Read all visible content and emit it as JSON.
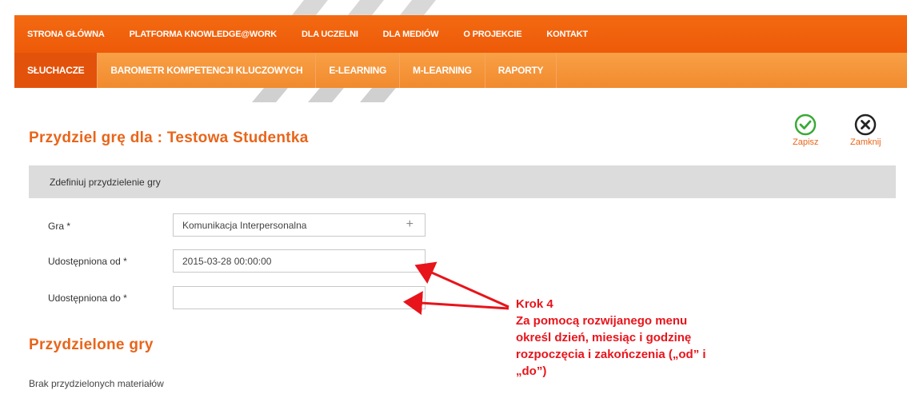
{
  "topnav": {
    "items": [
      "STRONA GŁÓWNA",
      "PLATFORMA KNOWLEDGE@WORK",
      "DLA UCZELNI",
      "DLA MEDIÓW",
      "O PROJEKCIE",
      "KONTAKT"
    ]
  },
  "subnav": {
    "items": [
      "SŁUCHACZE",
      "BAROMETR KOMPETENCJI KLUCZOWYCH",
      "E-LEARNING",
      "M-LEARNING",
      "RAPORTY"
    ],
    "active_index": 0
  },
  "page": {
    "title": "Przydziel grę dla : Testowa Studentka"
  },
  "actions": {
    "save_label": "Zapisz",
    "close_label": "Zamknij",
    "save_icon": "check-circle-icon",
    "close_icon": "x-circle-icon"
  },
  "form": {
    "section_title": "Zdefiniuj przydzielenie gry",
    "game_label": "Gra *",
    "game_value": "Komunikacja Interpersonalna",
    "from_label": "Udostępniona od *",
    "from_value": "2015-03-28 00:00:00",
    "to_label": "Udostępniona do *",
    "to_value": ""
  },
  "assigned": {
    "title": "Przydzielone gry",
    "empty_text": "Brak przydzielonych materiałów"
  },
  "annotation": {
    "lines": [
      "Krok 4",
      "Za pomocą rozwijanego menu",
      "określ dzień, miesiąc i godzinę",
      "rozpoczęcia i zakończenia  („od” i",
      "„do”)"
    ]
  },
  "colors": {
    "accent": "#e8651a",
    "topnav": "#f06410",
    "subnav": "#f5973a",
    "annotation": "#e8141b",
    "save_icon": "#3aaa35"
  }
}
